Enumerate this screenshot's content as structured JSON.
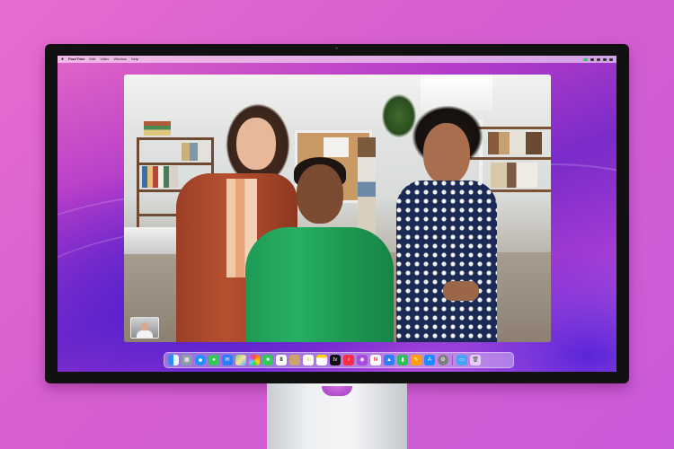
{
  "menubar": {
    "app_name": "FaceTime",
    "items": [
      "Edit",
      "Video",
      "Window",
      "Help"
    ]
  },
  "dock": {
    "icons": [
      "finder-icon",
      "launchpad-icon",
      "safari-icon",
      "messages-icon",
      "mail-icon",
      "maps-icon",
      "photos-icon",
      "facetime-icon",
      "calendar-icon",
      "contacts-icon",
      "reminders-icon",
      "notes-icon",
      "tv-icon",
      "music-icon",
      "podcasts-icon",
      "news-icon",
      "keynote-icon",
      "numbers-icon",
      "pages-icon",
      "app-store-icon",
      "system-preferences-icon",
      "screen-sharing-icon",
      "trash-icon"
    ],
    "calendar_day": "8",
    "tv_label": "tv"
  },
  "colors": {
    "background": "#d65fd0",
    "wallpaper_purple": "#7a2bc9",
    "facetime_green": "#34c759"
  }
}
